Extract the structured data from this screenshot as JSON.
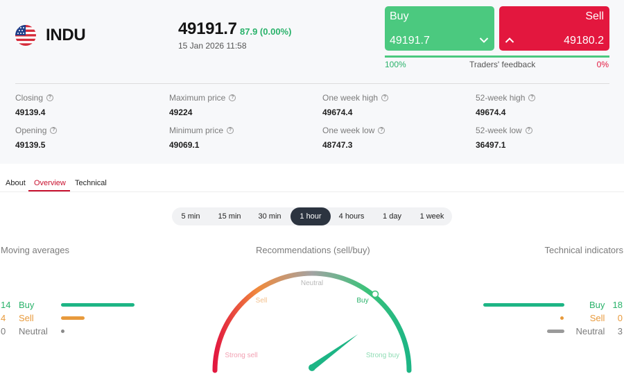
{
  "instrument": {
    "flag_icon": "us-flag-icon",
    "ticker": "INDU",
    "price": "49191.7",
    "change": "87.9 (0.00%)",
    "datetime": "15 Jan 2026 11:58"
  },
  "trade": {
    "buy_label": "Buy",
    "buy_price": "49191.7",
    "sell_label": "Sell",
    "sell_price": "49180.2",
    "buy_color": "#4bc97f",
    "sell_color": "#e3173e"
  },
  "feedback": {
    "buy_pct": "100%",
    "label": "Traders' feedback",
    "sell_pct": "0%"
  },
  "stats": [
    {
      "label": "Closing",
      "value": "49139.4"
    },
    {
      "label": "Maximum price",
      "value": "49224"
    },
    {
      "label": "One week high",
      "value": "49674.4"
    },
    {
      "label": "52-week high",
      "value": "49674.4"
    },
    {
      "label": "Opening",
      "value": "49139.5"
    },
    {
      "label": "Minimum price",
      "value": "49069.1"
    },
    {
      "label": "One week low",
      "value": "48747.3"
    },
    {
      "label": "52-week low",
      "value": "36497.1"
    }
  ],
  "tabs": [
    {
      "label": "About"
    },
    {
      "label": "Overview",
      "active": true
    },
    {
      "label": "Technical"
    }
  ],
  "periods": [
    {
      "label": "5 min"
    },
    {
      "label": "15 min"
    },
    {
      "label": "30 min"
    },
    {
      "label": "1 hour",
      "active": true
    },
    {
      "label": "4 hours"
    },
    {
      "label": "1 day"
    },
    {
      "label": "1 week"
    }
  ],
  "moving_averages": {
    "title": "Moving averages",
    "buy": {
      "count": "14",
      "label": "Buy"
    },
    "sell": {
      "count": "4",
      "label": "Sell"
    },
    "neutral": {
      "count": "0",
      "label": "Neutral"
    }
  },
  "recommendations": {
    "title": "Recommendations (sell/buy)",
    "labels": {
      "strong_sell": "Strong sell",
      "sell": "Sell",
      "neutral": "Neutral",
      "buy": "Buy",
      "strong_buy": "Strong buy"
    },
    "needle_level": 0.8
  },
  "technical_indicators": {
    "title": "Technical indicators",
    "buy": {
      "count": "18",
      "label": "Buy"
    },
    "sell": {
      "count": "0",
      "label": "Sell"
    },
    "neutral": {
      "count": "3",
      "label": "Neutral"
    }
  },
  "colors": {
    "buy_text": "#29b26a",
    "buy_bar": "#1db585",
    "sell_text": "#e89a3c",
    "neutral_text": "#7b7b7b",
    "active_tab": "#c8102e",
    "active_period": "#2c3440"
  }
}
